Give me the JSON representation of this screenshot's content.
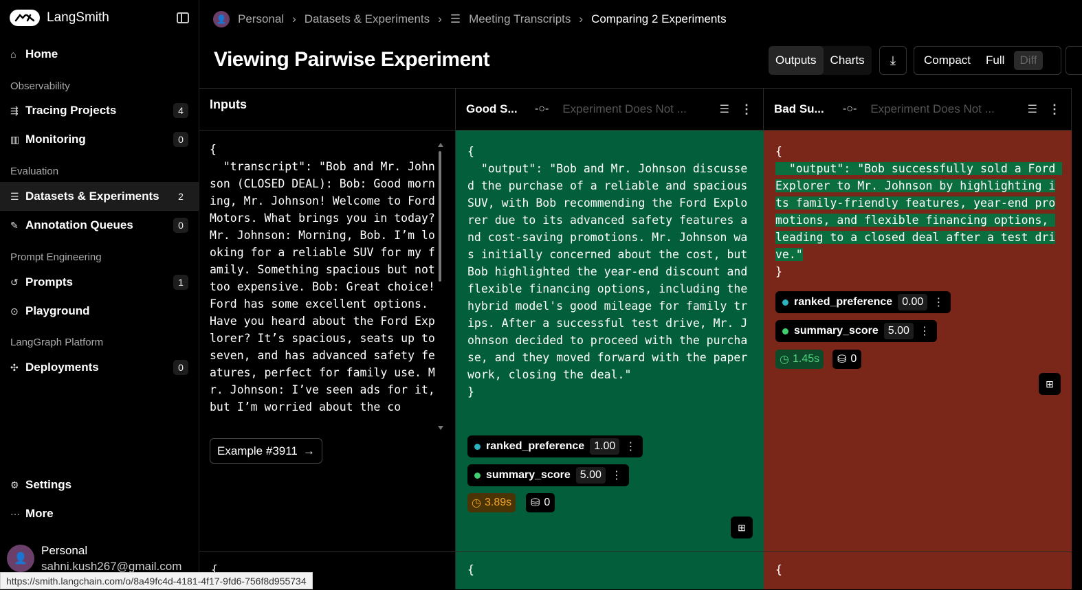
{
  "app": {
    "name": "LangSmith"
  },
  "sidebar": {
    "items": [
      {
        "label": "Home",
        "icon": "home-icon"
      },
      {
        "label": "Tracing Projects",
        "count": "4",
        "icon": "tracing-icon"
      },
      {
        "label": "Monitoring",
        "count": "0",
        "icon": "monitoring-icon"
      },
      {
        "label": "Datasets & Experiments",
        "count": "2",
        "icon": "database-icon"
      },
      {
        "label": "Annotation Queues",
        "count": "0",
        "icon": "pencil-icon"
      },
      {
        "label": "Prompts",
        "count": "1",
        "icon": "prompts-icon"
      },
      {
        "label": "Playground",
        "icon": "play-icon"
      },
      {
        "label": "Deployments",
        "count": "0",
        "icon": "deployments-icon"
      },
      {
        "label": "Settings",
        "icon": "gear-icon"
      },
      {
        "label": "More",
        "icon": "ellipsis-icon"
      }
    ],
    "sections": [
      "Observability",
      "Evaluation",
      "Prompt Engineering",
      "LangGraph Platform"
    ],
    "user": {
      "name": "Personal",
      "email": "sahni.kush267@gmail.com"
    }
  },
  "status_url": "https://smith.langchain.com/o/8a49fc4d-4181-4f17-9fd6-756f8d955734",
  "breadcrumb": [
    "Personal",
    "Datasets & Experiments",
    "Meeting Transcripts",
    "Comparing 2 Experiments"
  ],
  "page": {
    "title": "Viewing Pairwise Experiment"
  },
  "toolbar": {
    "outputs": "Outputs",
    "charts": "Charts",
    "compact": "Compact",
    "full": "Full",
    "diff": "Diff"
  },
  "columns": {
    "inputs_header": "Inputs",
    "good": {
      "name": "Good S...",
      "placeholder": "Experiment Does Not ..."
    },
    "bad": {
      "name": "Bad Su...",
      "placeholder": "Experiment Does Not ..."
    }
  },
  "inputs": {
    "text": "{\n  \"transcript\": \"Bob and Mr. Johnson (CLOSED DEAL): Bob: Good morning, Mr. Johnson! Welcome to Ford Motors. What brings you in today? Mr. Johnson: Morning, Bob. I’m looking for a reliable SUV for my family. Something spacious but not too expensive. Bob: Great choice! Ford has some excellent options. Have you heard about the Ford Explorer? It’s spacious, seats up to seven, and has advanced safety features, perfect for family use. Mr. Johnson: I’ve seen ads for it, but I’m worried about the co",
    "example_label": "Example #3911",
    "next_brace": "{"
  },
  "good_output": {
    "open": "{",
    "text": "  \"output\": \"Bob and Mr. Johnson discussed the purchase of a reliable and spacious SUV, with Bob recommending the Ford Explorer due to its advanced safety features and cost-saving promotions. Mr. Johnson was initially concerned about the cost, but Bob highlighted the year-end discount and flexible financing options, including the hybrid model's good mileage for family trips. After a successful test drive, Mr. Johnson decided to proceed with the purchase, and they moved forward with the paperwork, closing the deal.\"",
    "close": "}",
    "feedback": [
      {
        "key": "ranked_preference",
        "value": "1.00",
        "color": "#2bb3c0"
      },
      {
        "key": "summary_score",
        "value": "5.00",
        "color": "#3fcf6e"
      }
    ],
    "latency": "3.89s",
    "tokens": "0"
  },
  "bad_output": {
    "open": "{",
    "text": "  \"output\": \"Bob successfully sold a Ford Explorer to Mr. Johnson by highlighting its family-friendly features, year-end promotions, and flexible financing options, leading to a closed deal after a test drive.\"",
    "close": "}",
    "feedback": [
      {
        "key": "ranked_preference",
        "value": "0.00",
        "color": "#2bb3c0"
      },
      {
        "key": "summary_score",
        "value": "5.00",
        "color": "#3fcf6e"
      }
    ],
    "latency": "1.45s",
    "tokens": "0"
  }
}
